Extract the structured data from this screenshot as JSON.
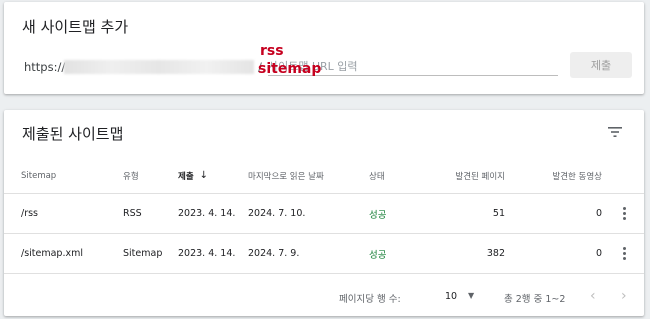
{
  "add_card": {
    "title": "새 사이트맵 추가",
    "url_prefix": "https://",
    "slash": "/",
    "input_placeholder": "사이트맵 URL 입력",
    "annotation_rss": "rss",
    "annotation_sitemap": "sitemap",
    "submit_label": "제출"
  },
  "list_card": {
    "title": "제출된 사이트맵",
    "filter_icon": "filter-icon",
    "columns": {
      "sitemap": "Sitemap",
      "type": "유형",
      "submitted": "제출",
      "last_read": "마지막으로 읽은 날짜",
      "status": "상태",
      "pages": "발견된 페이지",
      "videos": "발견한 동영상"
    },
    "sort_icon": "arrow-down-icon",
    "rows": [
      {
        "sitemap": "/rss",
        "type": "RSS",
        "submitted": "2023. 4. 14.",
        "last_read": "2024. 7. 10.",
        "status": "성공",
        "pages": "51",
        "videos": "0"
      },
      {
        "sitemap": "/sitemap.xml",
        "type": "Sitemap",
        "submitted": "2023. 4. 14.",
        "last_read": "2024. 7. 9.",
        "status": "성공",
        "pages": "382",
        "videos": "0"
      }
    ],
    "pager": {
      "rows_per_page_label": "페이지당 행 수:",
      "rows_per_page": "10",
      "range": "총 2행 중 1~2"
    }
  },
  "colors": {
    "status_success": "#188038",
    "annotation_red": "#c6001f",
    "background": "#eceff1"
  }
}
